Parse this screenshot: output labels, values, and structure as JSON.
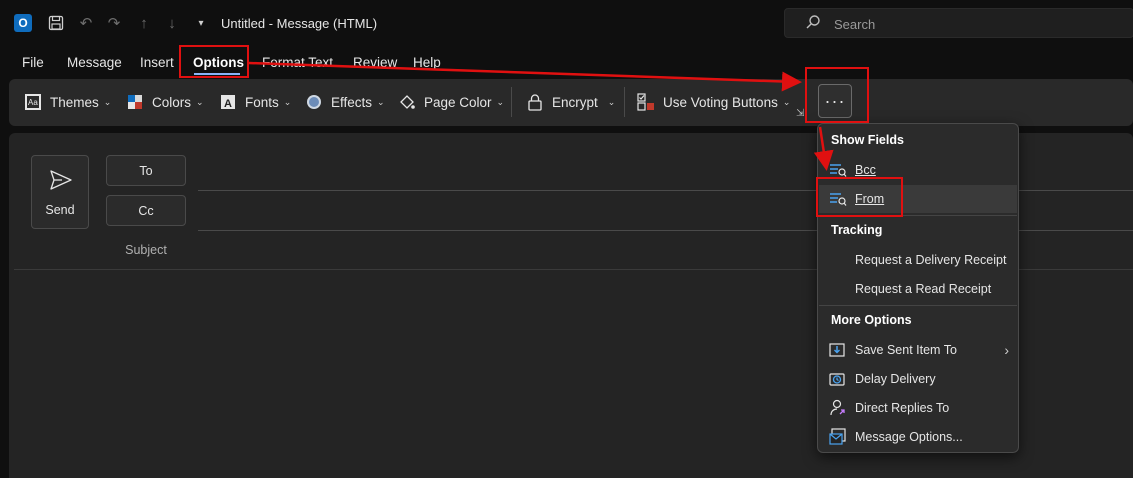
{
  "titlebar": {
    "title": "Untitled  -  Message (HTML)",
    "search_placeholder": "Search",
    "quick_access": [
      "save-icon",
      "undo-icon",
      "redo-icon",
      "up-arrow-icon",
      "down-arrow-icon",
      "customize-dropdown-icon"
    ]
  },
  "menu": {
    "tabs": [
      "File",
      "Message",
      "Insert",
      "Options",
      "Format Text",
      "Review",
      "Help"
    ],
    "active": "Options"
  },
  "ribbon": {
    "themes": "Themes",
    "colors": "Colors",
    "fonts": "Fonts",
    "effects": "Effects",
    "page_color": "Page Color",
    "encrypt": "Encrypt",
    "voting": "Use Voting Buttons",
    "more": "···"
  },
  "compose": {
    "send": "Send",
    "to": "To",
    "cc": "Cc",
    "subject": "Subject"
  },
  "dropdown": {
    "show_fields_header": "Show Fields",
    "bcc": "Bcc",
    "from": "From",
    "tracking_header": "Tracking",
    "delivery_receipt": "Request a Delivery Receipt",
    "read_receipt": "Request a Read Receipt",
    "more_options_header": "More Options",
    "save_sent": "Save Sent Item To",
    "delay_delivery": "Delay Delivery",
    "direct_replies": "Direct Replies To",
    "message_options": "Message Options..."
  },
  "colors": {
    "accent": "#0f6cbd",
    "annotation": "#e01010",
    "underline": "#8ab4f8"
  }
}
